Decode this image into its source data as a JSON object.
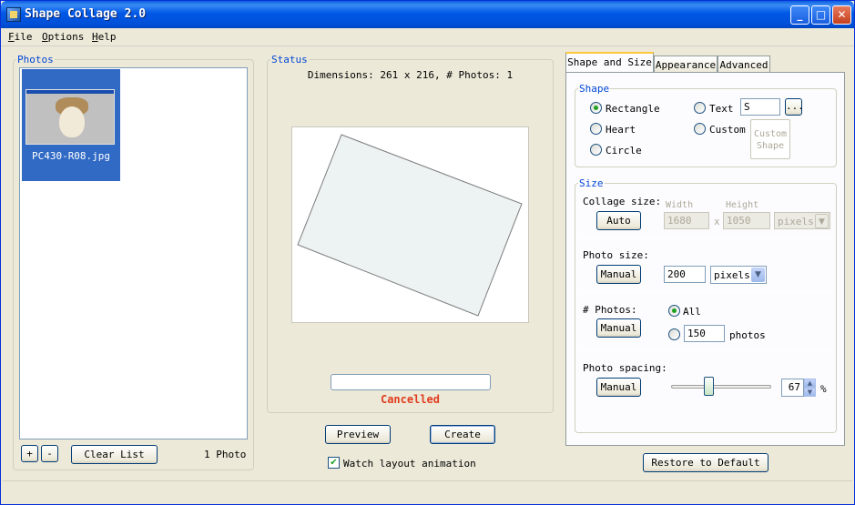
{
  "window": {
    "title": "Shape Collage 2.0",
    "minimize": "_",
    "maximize": "□",
    "close": "✕"
  },
  "menu": [
    {
      "key": "F",
      "rest": "ile"
    },
    {
      "key": "O",
      "rest": "ptions"
    },
    {
      "key": "H",
      "rest": "elp"
    }
  ],
  "photos": {
    "title": "Photos",
    "items": [
      {
        "name": "PC430-R08.jpg",
        "selected": true
      }
    ],
    "add_label": "+",
    "remove_label": "-",
    "clear_label": "Clear List",
    "count_text": "1 Photo"
  },
  "status": {
    "title": "Status",
    "dimensions_text": "Dimensions: 261 x 216, # Photos: 1",
    "progress": 0,
    "state_text": "Cancelled",
    "state_color": "#e03c1e"
  },
  "actions": {
    "preview_label": "Preview",
    "create_label": "Create",
    "watch_label": "Watch layout animation",
    "watch_checked": true,
    "checkmark": "✔"
  },
  "tabs": [
    {
      "label": "Shape and Size",
      "active": true
    },
    {
      "label": "Appearance",
      "active": false
    },
    {
      "label": "Advanced",
      "active": false
    }
  ],
  "shape": {
    "title": "Shape",
    "rectangle_label": "Rectangle",
    "heart_label": "Heart",
    "circle_label": "Circle",
    "text_label": "Text",
    "text_value": "S",
    "browse_label": "...",
    "custom_label": "Custom",
    "custom_shape_line1": "Custom",
    "custom_shape_line2": "Shape",
    "selected": "Rectangle"
  },
  "size": {
    "title": "Size",
    "collage_size_label": "Collage size:",
    "auto_label": "Auto",
    "width_label": "Width",
    "height_label": "Height",
    "width_value": "1680",
    "x_label": "x",
    "height_value": "1050",
    "collage_unit": "pixels",
    "photo_size_label": "Photo size:",
    "photo_manual_label": "Manual",
    "photo_size_value": "200",
    "photo_unit": "pixels",
    "num_photos_label": "# Photos:",
    "num_manual_label": "Manual",
    "all_label": "All",
    "num_photos_value": "150",
    "photos_suffix": "photos",
    "num_selected": "All",
    "spacing_label": "Photo spacing:",
    "spacing_manual_label": "Manual",
    "spacing_value": "67",
    "spacing_percent": "%",
    "spacing_fraction": 0.35
  },
  "restore_label": "Restore to Default"
}
